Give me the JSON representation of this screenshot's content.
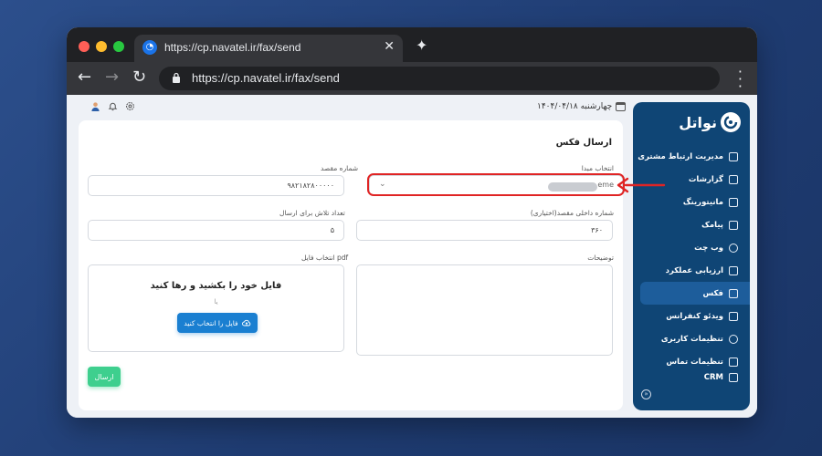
{
  "browser": {
    "tab_title": "https://cp.navatel.ir/fax/send",
    "url": "https://cp.navatel.ir/fax/send"
  },
  "header": {
    "date": "چهارشنبه ۱۴۰۴/۰۴/۱۸"
  },
  "sidebar": {
    "logo": "نواتل",
    "items": [
      {
        "label": "مدیریت ارتباط مشتری"
      },
      {
        "label": "گزارشات"
      },
      {
        "label": "مانیتورینگ"
      },
      {
        "label": "پیامک"
      },
      {
        "label": "وب چت"
      },
      {
        "label": "ارزیابی عملکرد"
      },
      {
        "label": "فکس"
      },
      {
        "label": "ویدئو کنفرانس"
      },
      {
        "label": "تنظیمات کاربری"
      },
      {
        "label": "تنظیمات تماس"
      },
      {
        "label": "CRM"
      }
    ],
    "active_index": 6
  },
  "form": {
    "title": "ارسال فکس",
    "source_label": "انتخاب مبدا",
    "source_value_suffix": "eme",
    "destination_label": "شماره مقصد",
    "destination_value": "۹۸۲۱۸۲۸۰۰۰۰۰",
    "extension_label": "شماره داخلی مقصد(اختیاری)",
    "extension_value": "۳۶۰",
    "retries_label": "تعداد تلاش برای ارسال",
    "retries_value": "۵",
    "description_label": "توضیحات",
    "file_label": "انتخاب فایل pdf",
    "dropzone_title": "فایل خود را بکشید و رها کنید",
    "dropzone_or": "یا",
    "choose_file_button": "فایل را انتخاب کنید",
    "submit_button": "ارسال"
  },
  "colors": {
    "sidebar_bg": "#0f4575",
    "primary": "#1a7fd1",
    "submit": "#3ecf8e",
    "highlight": "#e02424"
  }
}
